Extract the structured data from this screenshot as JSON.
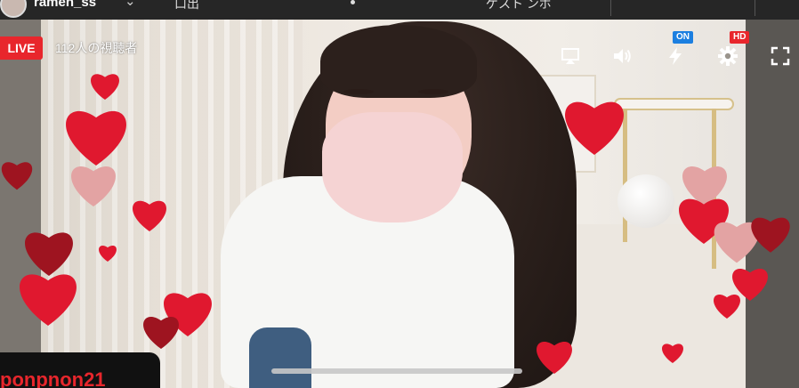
{
  "top_bar": {
    "channel_name": "ramen_ss",
    "right_partial_text": "ゲスト ンボ",
    "left_partial_text": "口出"
  },
  "live": {
    "badge": "LIVE",
    "viewers": "112人の視聴者"
  },
  "controls": {
    "airplay": "airplay-icon",
    "volume": "volume-icon",
    "lightning": "lightning-icon",
    "lightning_badge": "ON",
    "settings": "gear-icon",
    "settings_badge": "HD",
    "fullscreen": "fullscreen-icon"
  },
  "comment_user": "ponpnon21",
  "colors": {
    "live_red": "#e8262c",
    "on_blue": "#1c7fe0",
    "heart_red": "#e0182f",
    "heart_dark": "#9e1420",
    "heart_pale": "#e3a3a3"
  }
}
